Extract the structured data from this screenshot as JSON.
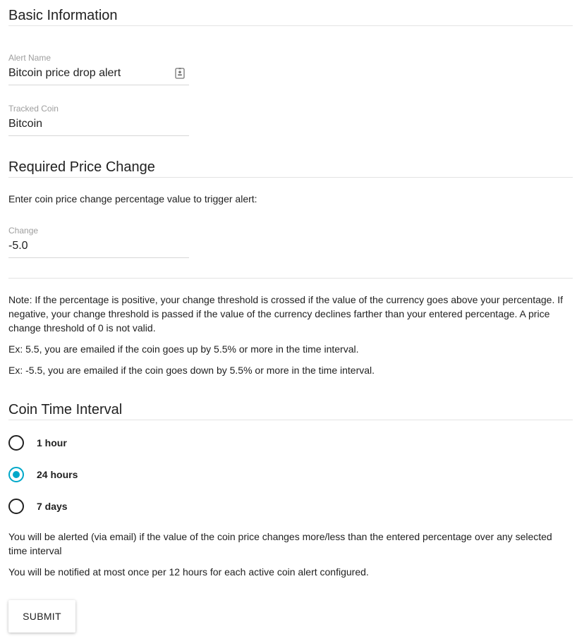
{
  "basic": {
    "title": "Basic Information",
    "alert_name": {
      "label": "Alert Name",
      "value": "Bitcoin price drop alert",
      "icon": "contact-card-icon"
    },
    "tracked_coin": {
      "label": "Tracked Coin",
      "value": "Bitcoin"
    }
  },
  "price_change": {
    "title": "Required Price Change",
    "instructions": "Enter coin price change percentage value to trigger alert:",
    "change": {
      "label": "Change",
      "value": "-5.0"
    },
    "note": "Note: If the percentage is positive, your change threshold is crossed if the value of the currency goes above your percentage. If negative, your change threshold is passed if the value of the currency declines farther than your entered percentage. A price change threshold of 0 is not valid.",
    "example_positive": "Ex: 5.5, you are emailed if the coin goes up by 5.5% or more in the time interval.",
    "example_negative": "Ex: -5.5, you are emailed if the coin goes down by 5.5% or more in the time interval."
  },
  "interval": {
    "title": "Coin Time Interval",
    "options": [
      {
        "label": "1 hour",
        "selected": false
      },
      {
        "label": "24 hours",
        "selected": true
      },
      {
        "label": "7 days",
        "selected": false
      }
    ],
    "info": "You will be alerted (via email) if the value of the coin price changes more/less than the entered percentage over any selected time interval",
    "frequency": "You will be notified at most once per 12 hours for each active coin alert configured."
  },
  "submit_label": "SUBMIT",
  "colors": {
    "accent": "#00a8c9",
    "text": "#212121",
    "label": "#9e9e9e",
    "divider": "#e3e3e3"
  }
}
